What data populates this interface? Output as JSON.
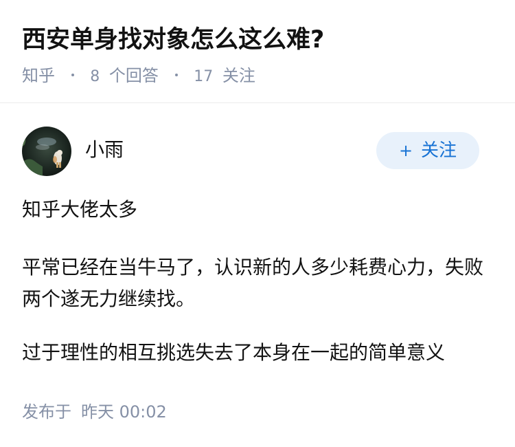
{
  "question": {
    "title": "西安单身找对象怎么这么难?",
    "source": "知乎",
    "answers_count": "8",
    "answers_label": "个回答",
    "followers_count": "17",
    "followers_label": "关注"
  },
  "author": {
    "name": "小雨",
    "avatar_icon": "avatar-photo",
    "follow_button": {
      "icon": "plus-icon",
      "plus_glyph": "+",
      "label": "关注"
    }
  },
  "answer": {
    "paragraphs": [
      "知乎大佬太多",
      "平常已经在当牛马了，认识新的人多少耗费心力，失败两个遂无力继续找。",
      "过于理性的相互挑选失去了本身在一起的简单意义"
    ]
  },
  "publish": {
    "prefix": "发布于",
    "time": "昨天 00:02"
  },
  "colors": {
    "title": "#121212",
    "meta": "#8590a6",
    "accent": "#1772d4",
    "follow_bg": "#e8f1fb"
  }
}
